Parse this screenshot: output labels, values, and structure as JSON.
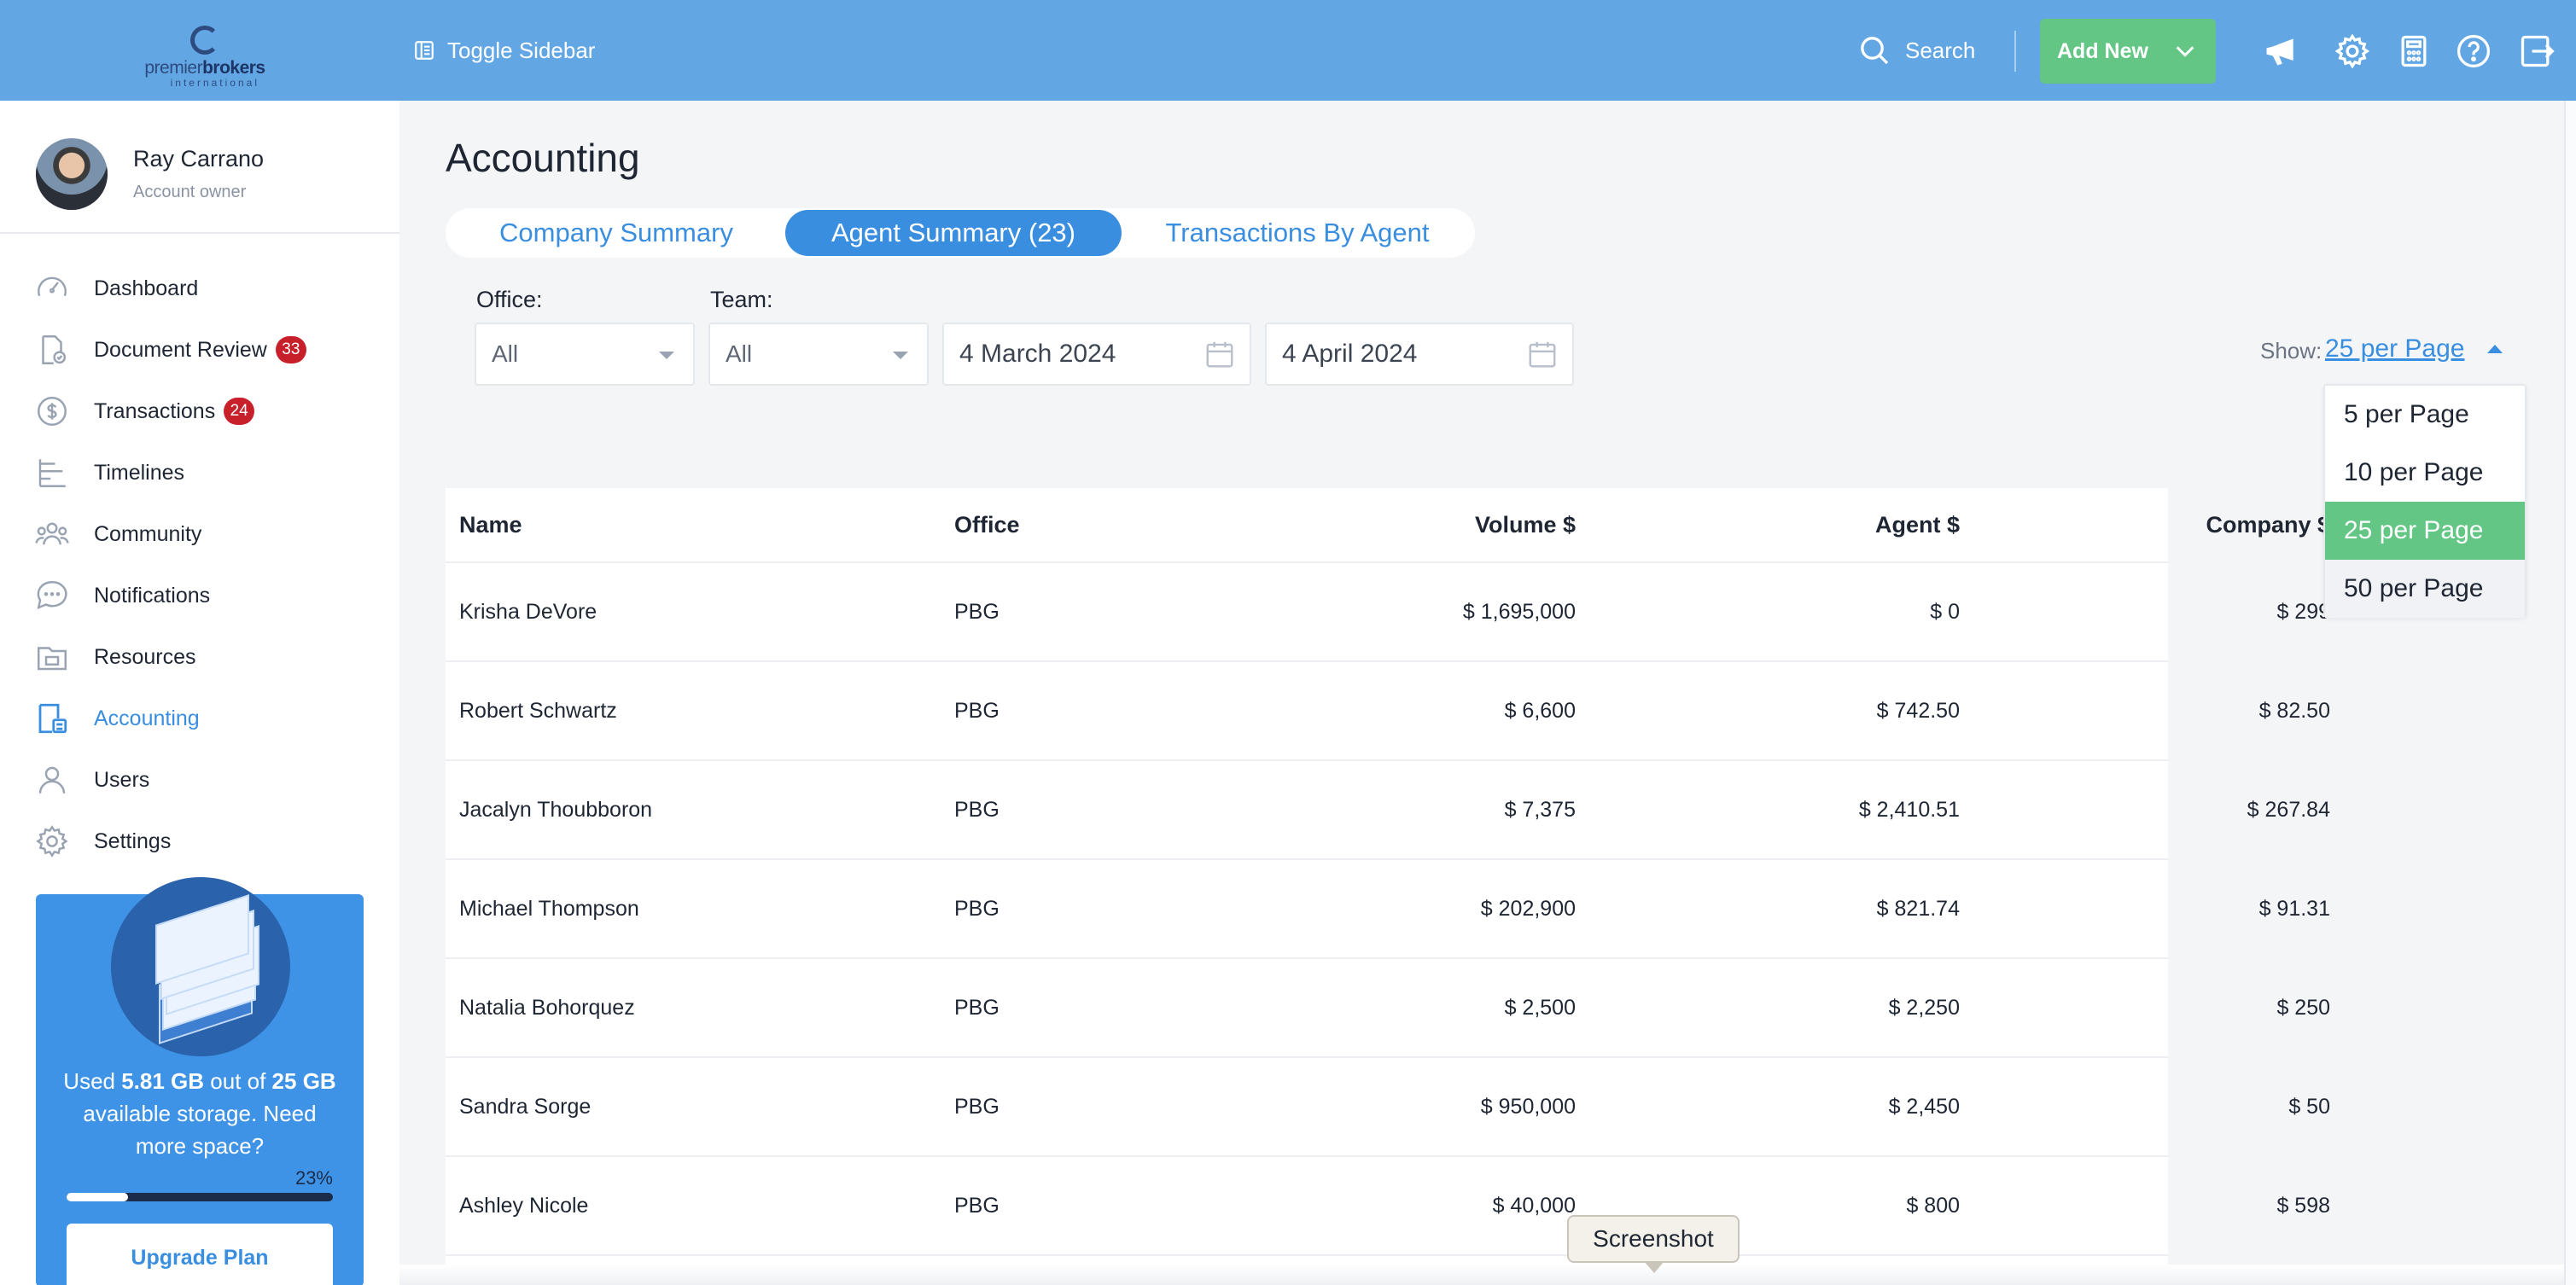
{
  "topbar": {
    "logo": {
      "word_light": "premier",
      "word_bold": "brokers",
      "sub": "international"
    },
    "toggle_sidebar": "Toggle Sidebar",
    "search": "Search",
    "add_new": "Add New",
    "icons": [
      "megaphone-icon",
      "gear-icon",
      "calculator-icon",
      "help-icon",
      "logout-icon"
    ]
  },
  "profile": {
    "name": "Ray Carrano",
    "role": "Account owner"
  },
  "sidebar": {
    "items": [
      {
        "label": "Dashboard",
        "icon": "gauge-icon"
      },
      {
        "label": "Document Review",
        "icon": "document-check-icon",
        "badge": "33"
      },
      {
        "label": "Transactions",
        "icon": "dollar-icon",
        "badge": "24"
      },
      {
        "label": "Timelines",
        "icon": "timeline-icon"
      },
      {
        "label": "Community",
        "icon": "people-icon"
      },
      {
        "label": "Notifications",
        "icon": "chat-bubble-icon"
      },
      {
        "label": "Resources",
        "icon": "folder-icon"
      },
      {
        "label": "Accounting",
        "icon": "accounting-icon",
        "active": true
      },
      {
        "label": "Users",
        "icon": "user-icon"
      },
      {
        "label": "Settings",
        "icon": "settings-icon"
      }
    ]
  },
  "storage": {
    "used_prefix": "Used ",
    "used": "5.81 GB",
    "mid": " out of ",
    "total": "25 GB",
    "suffix": " available storage. Need more space?",
    "percent_label": "23%",
    "percent": 0.23,
    "upgrade_label": "Upgrade Plan"
  },
  "page": {
    "title": "Accounting"
  },
  "tabs": [
    {
      "label": "Company Summary",
      "active": false
    },
    {
      "label": "Agent Summary (23)",
      "active": true
    },
    {
      "label": "Transactions By Agent",
      "active": false
    }
  ],
  "filters": {
    "office_label": "Office:",
    "office_value": "All",
    "team_label": "Team:",
    "team_value": "All",
    "date_from": "4 March 2024",
    "date_to": "4 April 2024"
  },
  "pagination": {
    "show_label": "Show:",
    "selected": "25 per Page",
    "options": [
      "5 per Page",
      "10 per Page",
      "25 per Page",
      "50 per Page"
    ]
  },
  "table": {
    "headers": [
      "Name",
      "Office",
      "Volume $",
      "Agent $",
      "Company $"
    ],
    "rows": [
      [
        "Krisha DeVore",
        "PBG",
        "$ 1,695,000",
        "$ 0",
        "$ 299"
      ],
      [
        "Robert Schwartz",
        "PBG",
        "$ 6,600",
        "$ 742.50",
        "$ 82.50"
      ],
      [
        "Jacalyn Thoubboron",
        "PBG",
        "$ 7,375",
        "$ 2,410.51",
        "$ 267.84"
      ],
      [
        "Michael Thompson",
        "PBG",
        "$ 202,900",
        "$ 821.74",
        "$ 91.31"
      ],
      [
        "Natalia Bohorquez",
        "PBG",
        "$ 2,500",
        "$ 2,250",
        "$ 250"
      ],
      [
        "Sandra Sorge",
        "PBG",
        "$ 950,000",
        "$ 2,450",
        "$ 50"
      ],
      [
        "Ashley Nicole",
        "PBG",
        "$ 40,000",
        "$ 800",
        "$ 598"
      ]
    ]
  },
  "tooltip": "Screenshot",
  "colors": {
    "accent": "#3a8ee0",
    "topbar": "#62a6e4",
    "green": "#63c685",
    "badge": "#c8202a"
  }
}
